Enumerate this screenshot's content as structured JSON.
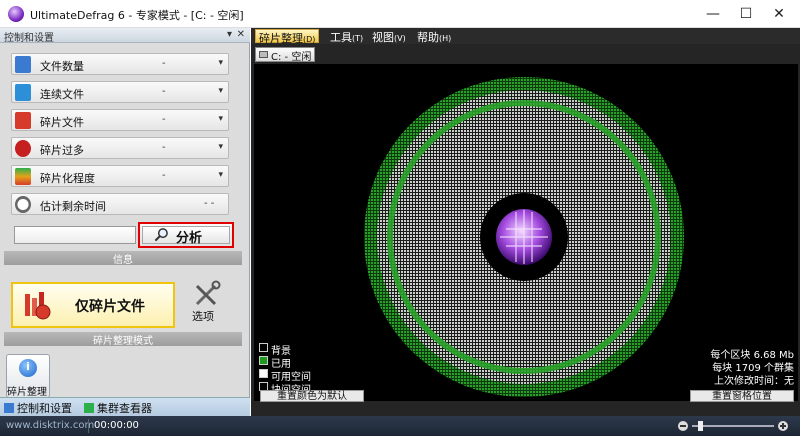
{
  "window": {
    "title": "UltimateDefrag 6 - 专家模式 - [C: - 空闲]",
    "controls": [
      "—",
      "☐",
      "✕"
    ]
  },
  "left_panel": {
    "header": "控制和设置",
    "pin_glyph": "▾",
    "close_glyph": "✕",
    "stats": [
      {
        "label": "文件数量",
        "value": "-",
        "icon_color": "#3a7ad0",
        "icon": "file-count-icon"
      },
      {
        "label": "连续文件",
        "value": "-",
        "icon_color": "#2d8fd8",
        "icon": "contiguous-files-icon"
      },
      {
        "label": "碎片文件",
        "value": "-",
        "icon_color": "#d63a2a",
        "icon": "fragmented-files-icon"
      },
      {
        "label": "碎片过多",
        "value": "-",
        "icon_color": "#c51f1f",
        "icon": "excessive-fragments-icon"
      },
      {
        "label": "碎片化程度",
        "value": "-",
        "icon_color": "#e5a21a",
        "icon": "fragmentation-level-icon"
      },
      {
        "label": "估计剩余时间",
        "value": "- -",
        "icon_color": "#666666",
        "icon": "clock-icon"
      }
    ],
    "analyze_button": "分析",
    "info_label": "信息",
    "mode_button": "仅碎片文件",
    "options_button": "选项",
    "mode_group_label": "碎片整理模式",
    "mini_button": "碎片整理",
    "tabs": [
      "控制和设置",
      "集群查看器"
    ]
  },
  "right_panel": {
    "menus": [
      {
        "label": "碎片整理",
        "key": "(D)",
        "active": true
      },
      {
        "label": "工具",
        "key": "(T)",
        "active": false
      },
      {
        "label": "视图",
        "key": "(V)",
        "active": false
      },
      {
        "label": "帮助",
        "key": "(H)",
        "active": false
      }
    ],
    "drive_tab": "C: - 空闲",
    "legend": [
      {
        "label": "背景",
        "color": "#000000"
      },
      {
        "label": "已用",
        "color": "#1f9a1f"
      },
      {
        "label": "可用空间",
        "color": "#ffffff"
      },
      {
        "label": "块间空间",
        "color": "#000000"
      }
    ],
    "stats": {
      "block_size": "每个区块 6.68 Mb",
      "clusters": "每块 1709 个群集",
      "last_modified": "上次修改时间：无"
    },
    "reset_color_button": "重置颜色为默认",
    "reset_grid_button": "重置窗格位置"
  },
  "status_bar": {
    "url": "www.disktrix.com",
    "time": "00:00:00"
  },
  "colors": {
    "used_green": "#1f9a1f",
    "free_gray": "#c9c9c9",
    "highlight_red": "#e00000"
  }
}
